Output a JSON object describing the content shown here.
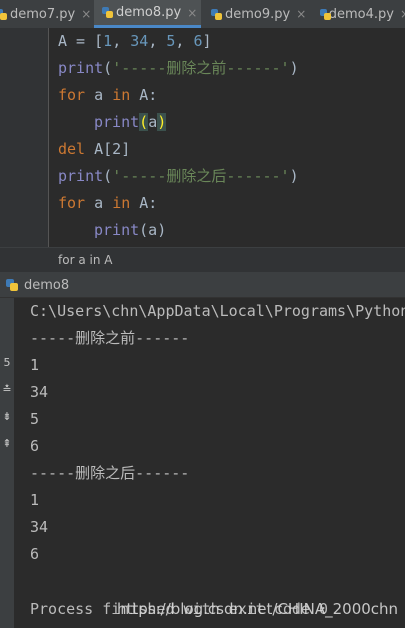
{
  "tabs": [
    {
      "label": "demo7.py",
      "close": "×"
    },
    {
      "label": "demo8.py",
      "close": "×"
    },
    {
      "label": "demo9.py",
      "close": "×"
    },
    {
      "label": "demo4.py",
      "close": "×"
    }
  ],
  "editor": {
    "line1": {
      "a": "A = [",
      "n1": "1",
      "c1": ", ",
      "n2": "34",
      "c2": ", ",
      "n3": "5",
      "c3": ", ",
      "n4": "6",
      "e": "]"
    },
    "line2": {
      "fn": "print",
      "p1": "(",
      "s": "'-----删除之前------'",
      "p2": ")"
    },
    "line3": {
      "k1": "for",
      "m": " a ",
      "k2": "in",
      "e": " A:"
    },
    "line4": {
      "fn": "print",
      "p1": "(",
      "a": "a",
      "p2": ")"
    },
    "line5": {
      "k": "del",
      "e": " A[2]"
    },
    "line6": {
      "fn": "print",
      "p1": "(",
      "s": "'-----删除之后------'",
      "p2": ")"
    },
    "line7": {
      "k1": "for",
      "m": " a ",
      "k2": "in",
      "e": " A:"
    },
    "line8": {
      "fn": "print",
      "e": "(a)"
    }
  },
  "breadcrumb": "for a in A",
  "run": {
    "tab_label": "demo8",
    "toolbar_glyphs": [
      "5",
      "≛",
      "⇟",
      "⇞"
    ],
    "output": [
      "C:\\Users\\chn\\AppData\\Local\\Programs\\Python",
      "-----删除之前------",
      "1",
      "34",
      "5",
      "6",
      "-----删除之后------",
      "1",
      "34",
      "6",
      "",
      "Process finished with exit code 0"
    ],
    "watermark": "https://blog.csdn.net/CHINA_2000chn"
  },
  "colors": {
    "background": "#2b2b2b",
    "keyword": "#cc7832",
    "builtin": "#8888c6",
    "string": "#6a8759",
    "number": "#6897bb",
    "active_tab_underline": "#4a88c7"
  }
}
